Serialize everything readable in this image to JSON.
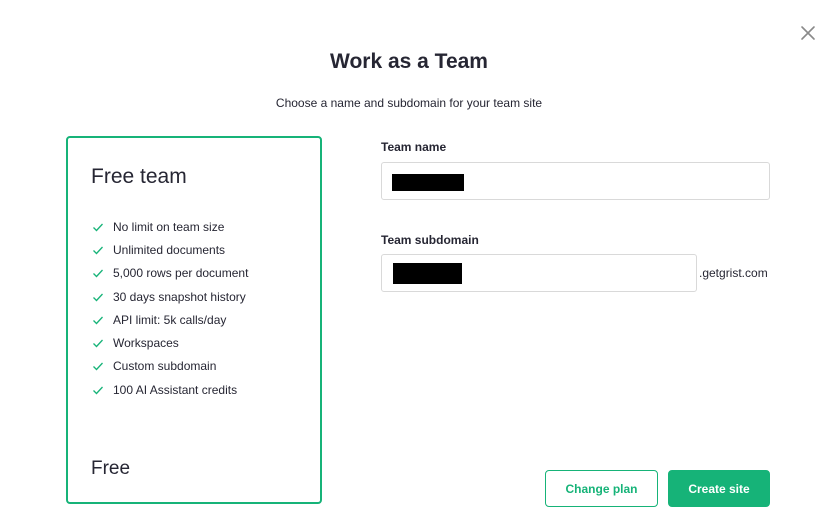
{
  "dialog": {
    "title": "Work as a Team",
    "subtitle": "Choose a name and subdomain for your team site",
    "close_icon": "close-icon"
  },
  "plan": {
    "name": "Free team",
    "features": [
      "No limit on team size",
      "Unlimited documents",
      "5,000 rows per document",
      "30 days snapshot history",
      "API limit: 5k calls/day",
      "Workspaces",
      "Custom subdomain",
      "100 AI Assistant credits"
    ],
    "feature_icon": "check-icon",
    "price": "Free"
  },
  "form": {
    "team_name_label": "Team name",
    "team_name_value": "",
    "team_subdomain_label": "Team subdomain",
    "team_subdomain_value": "",
    "subdomain_suffix": ".getgrist.com"
  },
  "actions": {
    "change_plan_label": "Change plan",
    "create_site_label": "Create site"
  },
  "colors": {
    "accent": "#16b378",
    "text": "#262633",
    "border": "#d9d9d9"
  }
}
